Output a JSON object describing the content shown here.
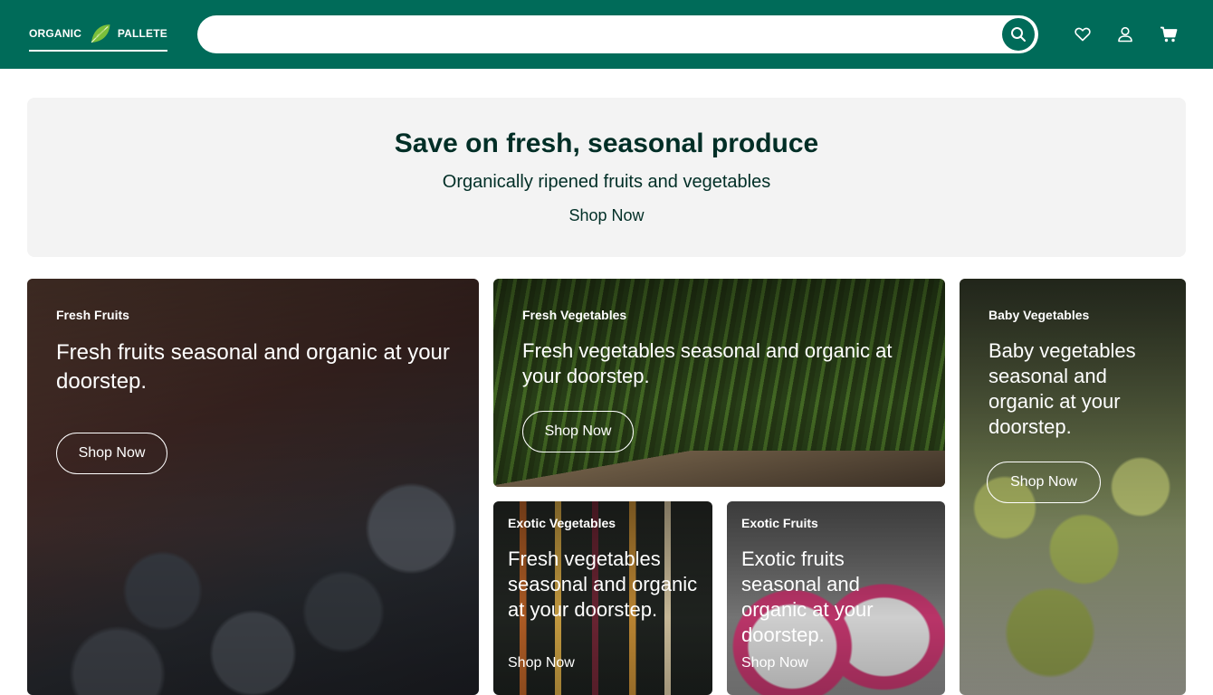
{
  "header": {
    "logo": {
      "left_text": "ORGANIC",
      "right_text": "PALLETE"
    },
    "search": {
      "value": "",
      "placeholder": ""
    },
    "icons": [
      "heart-icon",
      "user-icon",
      "cart-icon"
    ],
    "colors": {
      "header_bg": "#006b59",
      "accent": "#006b59"
    }
  },
  "promo": {
    "title": "Save on fresh, seasonal produce",
    "subtitle": "Organically ripened fruits and vegetables",
    "cta": "Shop Now"
  },
  "categories": [
    {
      "tag": "Fresh Fruits",
      "description": "Fresh fruits seasonal and organic at your doorstep.",
      "cta": "Shop Now"
    },
    {
      "tag": "Fresh Vegetables",
      "description": "Fresh vegetables seasonal and organic at your doorstep.",
      "cta": "Shop Now"
    },
    {
      "tag": "Baby Vegetables",
      "description": "Baby vegetables seasonal and organic at your doorstep.",
      "cta": "Shop Now"
    },
    {
      "tag": "Exotic Vegetables",
      "description": "Fresh vegetables seasonal and organic at your doorstep.",
      "cta": "Shop Now"
    },
    {
      "tag": "Exotic Fruits",
      "description": "Exotic fruits seasonal and organic at your doorstep.",
      "cta": "Shop Now"
    }
  ]
}
